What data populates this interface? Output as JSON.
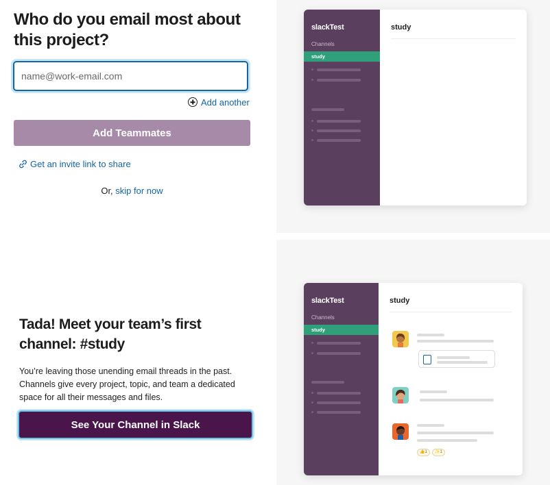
{
  "invite": {
    "heading": "Who do you email most about this project?",
    "email_placeholder": "name@work-email.com",
    "email_value": "",
    "add_another_label": "Add another",
    "add_teammates_label": "Add Teammates",
    "invite_link_label": "Get an invite link to share",
    "skip_prefix": "Or,",
    "skip_label": "skip for now"
  },
  "preview_top": {
    "workspace": "slackTest",
    "channels_label": "Channels",
    "active_channel": "study",
    "channel_title": "study"
  },
  "preview_bottom": {
    "workspace": "slackTest",
    "channels_label": "Channels",
    "active_channel": "study",
    "channel_title": "study",
    "reactions": [
      "👍1",
      "✨1"
    ]
  },
  "tada": {
    "heading": "Tada! Meet your team’s first channel: #study",
    "body": "You’re leaving those unending email threads in the past. Channels give every project, topic, and team a dedicated space for all their messages and files.",
    "button_label": "See Your Channel in Slack"
  },
  "colors": {
    "sidebar": "#5b3f5e",
    "active_channel": "#2fa07a",
    "link": "#1264a3",
    "primary_button": "#4a154b",
    "disabled_button": "#a68aa8"
  }
}
